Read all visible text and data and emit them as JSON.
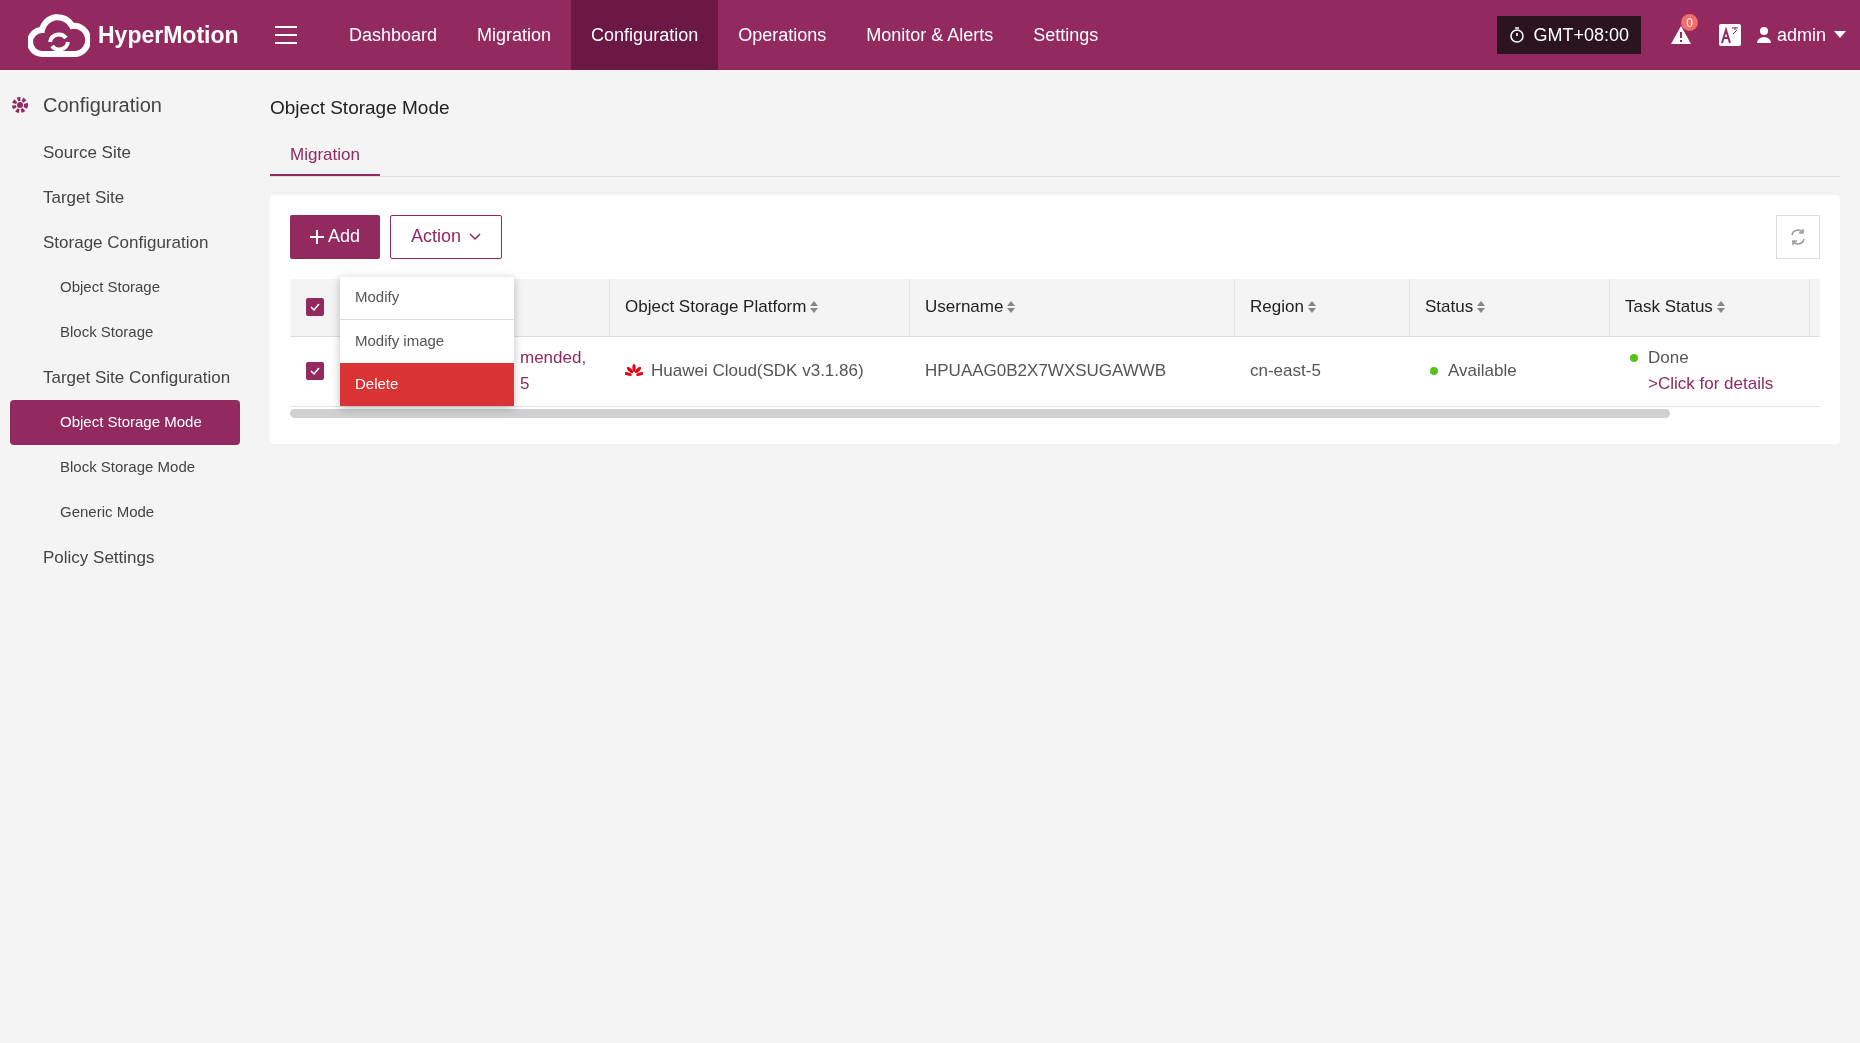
{
  "app": {
    "name": "HyperMotion"
  },
  "nav": [
    {
      "label": "Dashboard",
      "selected": false
    },
    {
      "label": "Migration",
      "selected": false
    },
    {
      "label": "Configuration",
      "selected": true
    },
    {
      "label": "Operations",
      "selected": false
    },
    {
      "label": "Monitor & Alerts",
      "selected": false
    },
    {
      "label": "Settings",
      "selected": false
    }
  ],
  "timezone": "GMT+08:00",
  "alerts_count": "0",
  "user": "admin",
  "sidebar": {
    "title": "Configuration",
    "items": [
      {
        "label": "Source Site",
        "selected": false
      },
      {
        "label": "Target Site",
        "selected": false
      },
      {
        "label": "Storage Configuration",
        "selected": false,
        "children": [
          {
            "label": "Object Storage",
            "selected": false
          },
          {
            "label": "Block Storage",
            "selected": false
          }
        ]
      },
      {
        "label": "Target Site Configuration",
        "selected": false,
        "children": [
          {
            "label": "Object Storage Mode",
            "selected": true
          },
          {
            "label": "Block Storage Mode",
            "selected": false
          },
          {
            "label": "Generic Mode",
            "selected": false
          }
        ]
      },
      {
        "label": "Policy Settings",
        "selected": false
      }
    ]
  },
  "page_title": "Object Storage Mode",
  "tabs": [
    {
      "label": "Migration",
      "selected": true
    }
  ],
  "toolbar": {
    "add": "Add",
    "action": "Action"
  },
  "action_menu": [
    {
      "label": "Modify",
      "highlighted": false
    },
    {
      "label": "Modify image",
      "highlighted": false
    },
    {
      "label": "Delete",
      "highlighted": true
    }
  ],
  "table": {
    "all_checked": true,
    "columns": [
      "Object Storage Platform",
      "Username",
      "Region",
      "Status",
      "Task Status"
    ],
    "rows": [
      {
        "checked": true,
        "column_1": [
          "mended,",
          "5"
        ],
        "platform": "Huawei Cloud(SDK v3.1.86)",
        "username": "HPUAAG0B2X7WXSUGAWWB",
        "region": "cn-east-5",
        "status": "Available",
        "task_status": "Done",
        "details_link": ">Click for details"
      }
    ]
  }
}
